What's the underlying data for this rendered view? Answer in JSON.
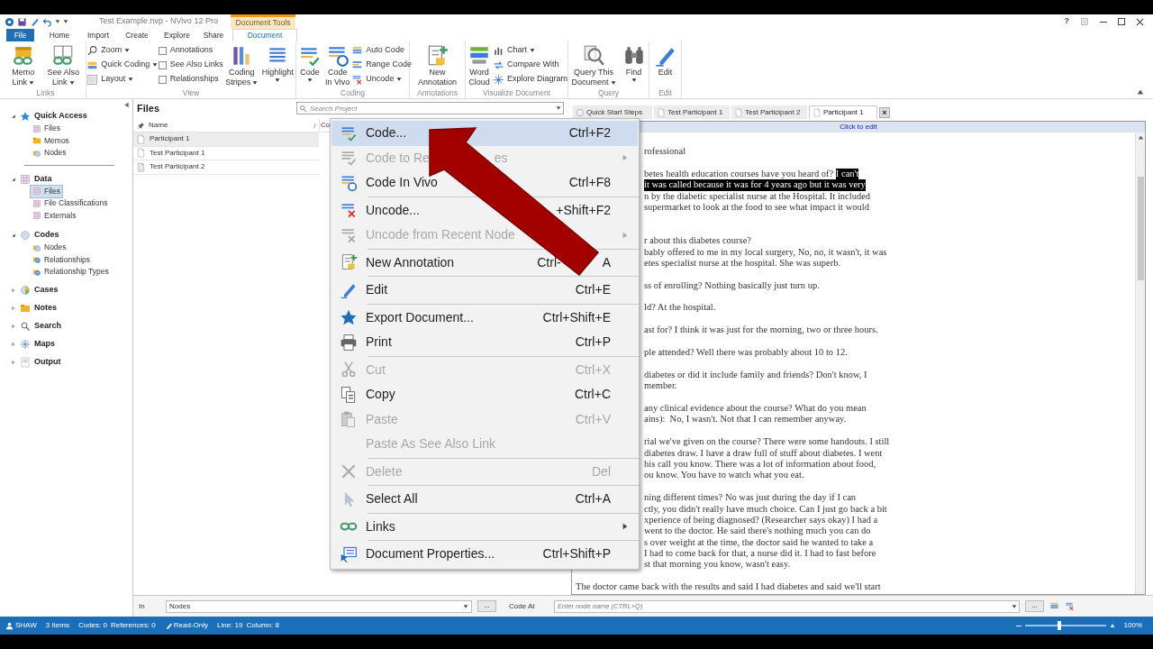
{
  "window": {
    "title": "Test Example.nvp - NVivo 12 Pro",
    "context_tab_group": "Document Tools",
    "help": "?"
  },
  "tabs": [
    {
      "label": "File",
      "selected": false,
      "kind": "file"
    },
    {
      "label": "Home",
      "selected": false,
      "kind": "tab"
    },
    {
      "label": "Import",
      "selected": false,
      "kind": "tab"
    },
    {
      "label": "Create",
      "selected": false,
      "kind": "tab"
    },
    {
      "label": "Explore",
      "selected": false,
      "kind": "tab"
    },
    {
      "label": "Share",
      "selected": false,
      "kind": "tab"
    },
    {
      "label": "Document",
      "selected": true,
      "kind": "tab"
    }
  ],
  "ribbon": [
    {
      "label": "Links",
      "columns": [
        {
          "kind": "large",
          "lines": [
            "Memo",
            "Link"
          ],
          "dropdown": true
        },
        {
          "kind": "large",
          "lines": [
            "See Also",
            "Link"
          ],
          "dropdown": true
        }
      ]
    },
    {
      "label": "View",
      "columns": [
        {
          "kind": "stack",
          "items": [
            {
              "kind": "small",
              "label": "Zoom",
              "dropdown": true
            },
            {
              "kind": "small",
              "label": "Quick Coding",
              "dropdown": true
            },
            {
              "kind": "small",
              "label": "Layout",
              "dropdown": true
            }
          ]
        },
        {
          "kind": "stack",
          "items": [
            {
              "kind": "check",
              "label": "Annotations",
              "checked": false
            },
            {
              "kind": "check",
              "label": "See Also Links",
              "checked": false
            },
            {
              "kind": "check",
              "label": "Relationships",
              "checked": false
            }
          ]
        },
        {
          "kind": "large",
          "lines": [
            "Coding",
            "Stripes"
          ],
          "dropdown": true
        },
        {
          "kind": "large",
          "lines": [
            "Highlight"
          ],
          "dropdown": true
        }
      ]
    },
    {
      "label": "Coding",
      "columns": [
        {
          "kind": "large",
          "lines": [
            "Code"
          ],
          "dropdown": true
        },
        {
          "kind": "large",
          "lines": [
            "Code",
            "In Vivo"
          ],
          "dropdown": false
        },
        {
          "kind": "stack",
          "items": [
            {
              "kind": "small",
              "label": "Auto Code",
              "dropdown": false
            },
            {
              "kind": "small",
              "label": "Range Code",
              "dropdown": false
            },
            {
              "kind": "small",
              "label": "Uncode",
              "dropdown": true
            }
          ]
        }
      ]
    },
    {
      "label": "Annotations",
      "columns": [
        {
          "kind": "large",
          "lines": [
            "New",
            "Annotation"
          ],
          "dropdown": false
        }
      ]
    },
    {
      "label": "Visualize Document",
      "columns": [
        {
          "kind": "large",
          "lines": [
            "Word",
            "Cloud"
          ],
          "dropdown": false
        },
        {
          "kind": "stack",
          "items": [
            {
              "kind": "small",
              "label": "Chart",
              "dropdown": true
            },
            {
              "kind": "small",
              "label": "Compare With",
              "dropdown": false
            },
            {
              "kind": "small",
              "label": "Explore Diagram",
              "dropdown": false
            }
          ]
        }
      ]
    },
    {
      "label": "Query",
      "columns": [
        {
          "kind": "large",
          "lines": [
            "Query This",
            "Document"
          ],
          "dropdown": true
        },
        {
          "kind": "large",
          "lines": [
            "Find"
          ],
          "dropdown": true
        }
      ]
    },
    {
      "label": "Edit",
      "columns": [
        {
          "kind": "large",
          "lines": [
            "Edit"
          ],
          "dropdown": false
        }
      ]
    }
  ],
  "navigation": [
    {
      "label": "Quick Access",
      "expanded": true,
      "children": [
        {
          "label": "Files",
          "selected": false
        },
        {
          "label": "Memos",
          "selected": false
        },
        {
          "label": "Nodes",
          "selected": false
        }
      ]
    },
    {
      "label": "Data",
      "expanded": true,
      "children": [
        {
          "label": "Files",
          "selected": true
        },
        {
          "label": "File Classifications",
          "selected": false
        },
        {
          "label": "Externals",
          "selected": false
        }
      ]
    },
    {
      "label": "Codes",
      "expanded": true,
      "children": [
        {
          "label": "Nodes",
          "selected": false
        },
        {
          "label": "Relationships",
          "selected": false
        },
        {
          "label": "Relationship Types",
          "selected": false
        }
      ]
    },
    {
      "label": "Cases",
      "expanded": false
    },
    {
      "label": "Notes",
      "expanded": false
    },
    {
      "label": "Search",
      "expanded": false
    },
    {
      "label": "Maps",
      "expanded": false
    },
    {
      "label": "Output",
      "expanded": false
    }
  ],
  "file_list": {
    "title": "Files",
    "search": {
      "placeholder": "Search Project"
    },
    "columns": [
      "Name",
      "Co"
    ],
    "rows": [
      {
        "name": "Participant 1",
        "selected": true
      },
      {
        "name": "Test Participant 1",
        "selected": false
      },
      {
        "name": "Test Participant 2",
        "selected": false
      }
    ]
  },
  "document_tabs": [
    {
      "label": "Quick Start Steps",
      "selected": false
    },
    {
      "label": "Test Participant 1",
      "selected": false
    },
    {
      "label": "Test Participant 2",
      "selected": false
    },
    {
      "label": "Participant 1",
      "selected": true,
      "close": "×"
    }
  ],
  "document": {
    "edit_bar": "Click to edit",
    "paragraphs": [
      [
        [
          {
            "text": "rofessional",
            "selected": false
          }
        ]
      ],
      [
        [
          {
            "text": "betes health education courses have you heard of? ",
            "selected": false
          },
          {
            "text": "I can't",
            "selected": true
          }
        ],
        [
          {
            "text": "it was called because it was for 4 years ago but it was very",
            "selected": true
          }
        ],
        [
          {
            "text": "n by the diabetic specialist nurse at the Hospital. It included",
            "selected": false
          }
        ],
        [
          {
            "text": "supermarket to look at the food to see what impact it would",
            "selected": false
          }
        ]
      ],
      [
        [
          {
            "text": "r about this diabetes course?",
            "selected": false
          }
        ],
        [
          {
            "text": "bably offered to me in my local surgery, No, no, it wasn't, it was",
            "selected": false
          }
        ],
        [
          {
            "text": "etes specialist nurse at the hospital. She was superb.",
            "selected": false
          }
        ]
      ],
      [
        [
          {
            "text": "ss of enrolling? Nothing basically just turn up.",
            "selected": false
          }
        ]
      ],
      [
        [
          {
            "text": "ld? At the hospital.",
            "selected": false
          }
        ]
      ],
      [
        [
          {
            "text": "ast for? I think it was just for the morning, two or three hours.",
            "selected": false
          }
        ]
      ],
      [
        [
          {
            "text": "ple attended? Well there was probably about 10 to 12.",
            "selected": false
          }
        ]
      ],
      [
        [
          {
            "text": "diabetes or did it include family and friends? Don't know, I",
            "selected": false
          }
        ],
        [
          {
            "text": "member.",
            "selected": false
          }
        ]
      ],
      [
        [
          {
            "text": "any clinical evidence about the course? What do you mean",
            "selected": false
          }
        ],
        [
          {
            "text": "ains):  No, I wasn't. Not that I can remember anyway.",
            "selected": false
          }
        ]
      ],
      [
        [
          {
            "text": "rial we've given on the course? There were some handouts. I still",
            "selected": false
          }
        ],
        [
          {
            "text": "diabetes draw. I have a draw full of stuff about diabetes. I went",
            "selected": false
          }
        ],
        [
          {
            "text": "his call you know. There was a lot of information about food,",
            "selected": false
          }
        ],
        [
          {
            "text": "ou know. You have to watch what you eat.",
            "selected": false
          }
        ]
      ],
      [
        [
          {
            "text": "ning different times? No was just during the day if I can",
            "selected": false
          }
        ],
        [
          {
            "text": "ctly, you didn't really have much choice. Can I just go back a bit",
            "selected": false
          }
        ],
        [
          {
            "text": "xperience of being diagnosed? (Researcher says okay) I had a",
            "selected": false
          }
        ],
        [
          {
            "text": "went to the doctor. He said there's nothing much you can do",
            "selected": false
          }
        ],
        [
          {
            "text": "s over weight at the time, the doctor said he wanted to take a",
            "selected": false
          }
        ],
        [
          {
            "text": "I had to come back for that, a nurse did it. I had to fast before",
            "selected": false
          }
        ],
        [
          {
            "text": "st that morning you know, wasn't easy.",
            "selected": false
          }
        ]
      ],
      [
        [
          {
            "text": "The doctor came back with the results and said I had diabetes and said we'll start",
            "selected": false
          }
        ]
      ]
    ]
  },
  "context_menu": [
    {
      "label": "Code...",
      "shortcut": "Ctrl+F2",
      "selected": true,
      "disabled": false,
      "submenu": false,
      "separator_after": false
    },
    {
      "label": "Code to Re",
      "label_tail": "es",
      "selected": false,
      "disabled": true,
      "submenu": true,
      "separator_after": false
    },
    {
      "label": "Code In Vivo",
      "shortcut": "Ctrl+F8",
      "selected": false,
      "disabled": false,
      "submenu": false,
      "separator_after": true
    },
    {
      "label": "Uncode...",
      "shortcut": "+Shift+F2",
      "selected": false,
      "disabled": false,
      "submenu": false,
      "separator_after": false
    },
    {
      "label": "Uncode from Recent Node",
      "selected": false,
      "disabled": true,
      "submenu": true,
      "separator_after": true
    },
    {
      "label": "New Annotation",
      "shortcut": "Ctrl-",
      "shortcut_tail": "A",
      "selected": false,
      "disabled": false,
      "submenu": false,
      "separator_after": true
    },
    {
      "label": "Edit",
      "shortcut": "Ctrl+E",
      "selected": false,
      "disabled": false,
      "submenu": false,
      "separator_after": true
    },
    {
      "label": "Export Document...",
      "shortcut": "Ctrl+Shift+E",
      "selected": false,
      "disabled": false,
      "submenu": false,
      "separator_after": false
    },
    {
      "label": "Print",
      "shortcut": "Ctrl+P",
      "selected": false,
      "disabled": false,
      "submenu": false,
      "separator_after": true
    },
    {
      "label": "Cut",
      "shortcut": "Ctrl+X",
      "selected": false,
      "disabled": true,
      "submenu": false,
      "separator_after": false
    },
    {
      "label": "Copy",
      "shortcut": "Ctrl+C",
      "selected": false,
      "disabled": false,
      "submenu": false,
      "separator_after": false
    },
    {
      "label": "Paste",
      "shortcut": "Ctrl+V",
      "selected": false,
      "disabled": true,
      "submenu": false,
      "separator_after": false
    },
    {
      "label": "Paste As See Also Link",
      "selected": false,
      "disabled": true,
      "submenu": false,
      "separator_after": true
    },
    {
      "label": "Delete",
      "shortcut": "Del",
      "selected": false,
      "disabled": true,
      "submenu": false,
      "separator_after": true
    },
    {
      "label": "Select All",
      "shortcut": "Ctrl+A",
      "selected": false,
      "disabled": false,
      "submenu": false,
      "separator_after": true
    },
    {
      "label": "Links",
      "selected": false,
      "disabled": false,
      "submenu": true,
      "separator_after": true
    },
    {
      "label": "Document Properties...",
      "shortcut": "Ctrl+Shift+P",
      "selected": false,
      "disabled": false,
      "submenu": false,
      "separator_after": false
    }
  ],
  "code_bar": {
    "in_label": "In",
    "in_value": "Nodes",
    "browse": "...",
    "code_at_label": "Code At",
    "node_field": {
      "placeholder": "Enter node name (CTRL+Q)"
    },
    "browse_2": "..."
  },
  "status_bar": {
    "user": "SHAW",
    "items": "3 Items",
    "codes": "Codes: 0",
    "references": "References: 0",
    "mode": "Read-Only",
    "line": "Line: 19",
    "column": "Column: 8",
    "zoom": {
      "level": 0.4,
      "reading": "100%"
    }
  }
}
